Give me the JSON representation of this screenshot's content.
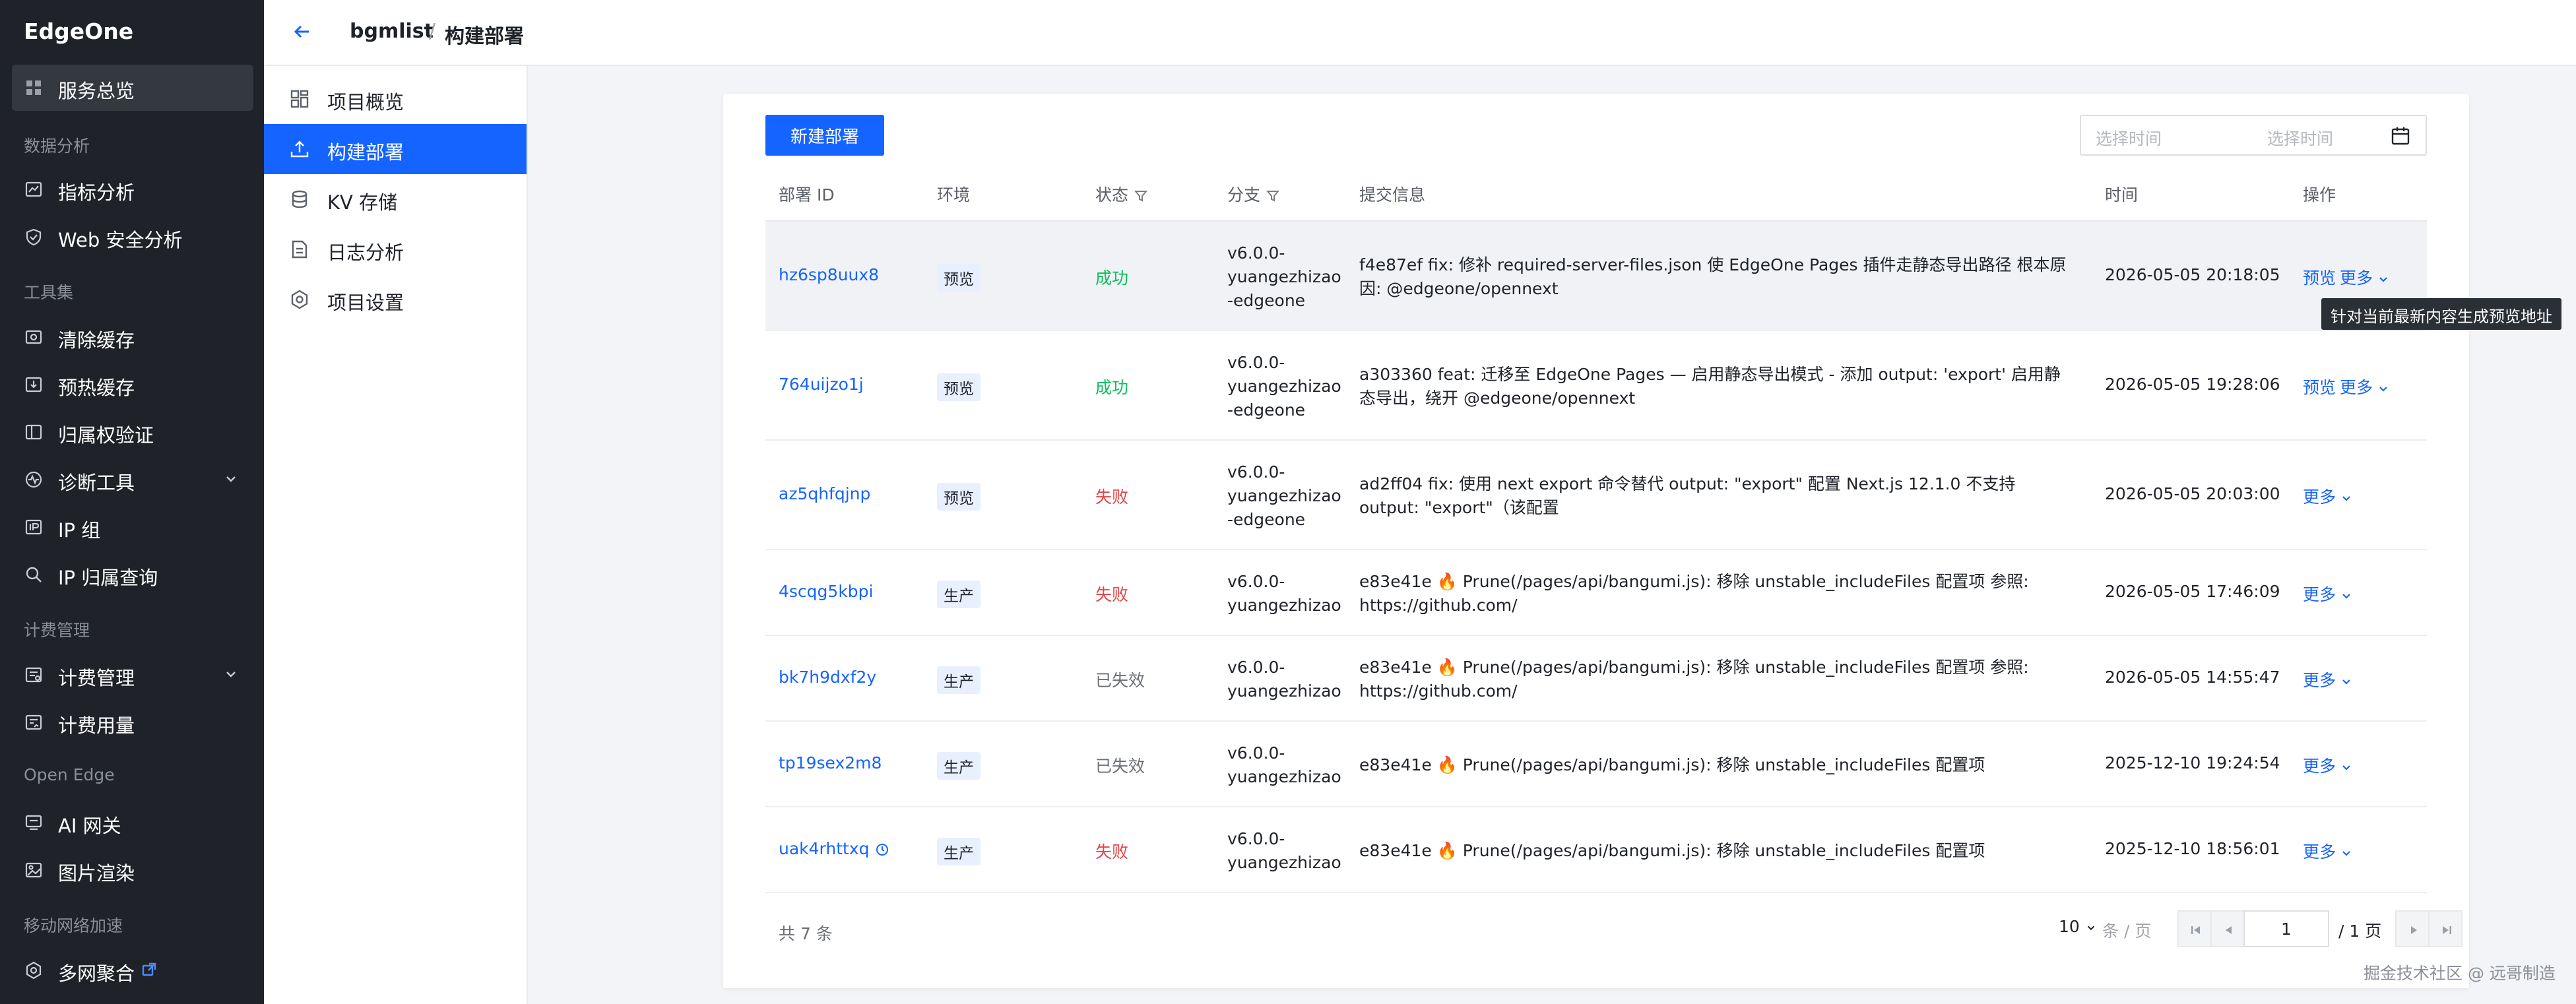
{
  "sidebar": {
    "brand": "EdgeOne",
    "overview": "服务总览",
    "sections": {
      "data_analysis": "数据分析",
      "tools": "工具集",
      "billing": "计费管理",
      "open_edge": "Open Edge",
      "mobile": "移动网络加速"
    },
    "items": {
      "metrics": "指标分析",
      "web_security": "Web 安全分析",
      "purge_cache": "清除缓存",
      "prefetch_cache": "预热缓存",
      "ownership": "归属权验证",
      "diagnostics": "诊断工具",
      "ip_group": "IP 组",
      "ip_lookup": "IP 归属查询",
      "billing_mgmt": "计费管理",
      "billing_usage": "计费用量",
      "ai_gateway": "AI 网关",
      "image_render": "图片渲染",
      "multi_network": "多网聚合"
    }
  },
  "header": {
    "project": "bgmlist",
    "separator": "/",
    "page": "构建部署"
  },
  "submenu": {
    "overview": "项目概览",
    "build_deploy": "构建部署",
    "kv": "KV 存储",
    "logs": "日志分析",
    "settings": "项目设置"
  },
  "toolbar": {
    "new_deploy": "新建部署",
    "date_start_placeholder": "选择时间",
    "date_end_placeholder": "选择时间"
  },
  "table": {
    "columns": {
      "id": "部署 ID",
      "env": "环境",
      "status": "状态",
      "branch": "分支",
      "commit": "提交信息",
      "time": "时间",
      "actions": "操作"
    },
    "rows": [
      {
        "id": "hz6sp8uux8",
        "env": "预览",
        "status": "成功",
        "branch": "v6.0.0-\nyuangezhizao\n-edgeone",
        "commit": "f4e87ef fix: 修补 required-server-files.json 使 EdgeOne Pages 插件走静态导出路径 根本原因: @edgeone/opennext",
        "time": "2026-05-05 20:18:05",
        "preview": "预览",
        "more": "更多"
      },
      {
        "id": "764uijzo1j",
        "env": "预览",
        "status": "成功",
        "branch": "v6.0.0-\nyuangezhizao\n-edgeone",
        "commit": "a303360 feat: 迁移至 EdgeOne Pages — 启用静态导出模式 - 添加 output: 'export' 启用静态导出，绕开 @edgeone/opennext",
        "time": "2026-05-05 19:28:06",
        "preview": "预览",
        "more": "更多"
      },
      {
        "id": "az5qhfqjnp",
        "env": "预览",
        "status": "失败",
        "branch": "v6.0.0-\nyuangezhizao\n-edgeone",
        "commit": "ad2ff04 fix: 使用 next export 命令替代 output: \"export\" 配置 Next.js 12.1.0 不支持 output: \"export\"（该配置",
        "time": "2026-05-05 20:03:00",
        "more": "更多"
      },
      {
        "id": "4scqg5kbpi",
        "env": "生产",
        "status": "失败",
        "branch": "v6.0.0-\nyuangezhizao",
        "commit": "e83e41e 🔥 Prune(/pages/api/bangumi.js): 移除 unstable_includeFiles 配置项 参照: https://github.com/",
        "time": "2026-05-05 17:46:09",
        "more": "更多"
      },
      {
        "id": "bk7h9dxf2y",
        "env": "生产",
        "status": "已失效",
        "branch": "v6.0.0-\nyuangezhizao",
        "commit": "e83e41e 🔥 Prune(/pages/api/bangumi.js): 移除 unstable_includeFiles 配置项 参照: https://github.com/",
        "time": "2026-05-05 14:55:47",
        "more": "更多"
      },
      {
        "id": "tp19sex2m8",
        "env": "生产",
        "status": "已失效",
        "branch": "v6.0.0-\nyuangezhizao",
        "commit": "e83e41e 🔥 Prune(/pages/api/bangumi.js): 移除 unstable_includeFiles 配置项",
        "time": "2025-12-10 19:24:54",
        "more": "更多"
      },
      {
        "id": "uak4rhttxq",
        "env": "生产",
        "status": "失败",
        "branch": "v6.0.0-\nyuangezhizao",
        "commit": "e83e41e 🔥 Prune(/pages/api/bangumi.js): 移除 unstable_includeFiles 配置项",
        "time": "2025-12-10 18:56:01",
        "more": "更多"
      }
    ]
  },
  "pagination": {
    "total": "共 7 条",
    "page_size": "10",
    "per_page": "条 / 页",
    "current_page": "1",
    "total_pages": "/ 1 页"
  },
  "tooltip": "针对当前最新内容生成预览地址",
  "watermark": "掘金技术社区 @ 远哥制造",
  "colors": {
    "sidebar_bg": "#1f2228",
    "accent": "#1664ff",
    "success": "#0abf5b",
    "fail": "#e54545"
  }
}
